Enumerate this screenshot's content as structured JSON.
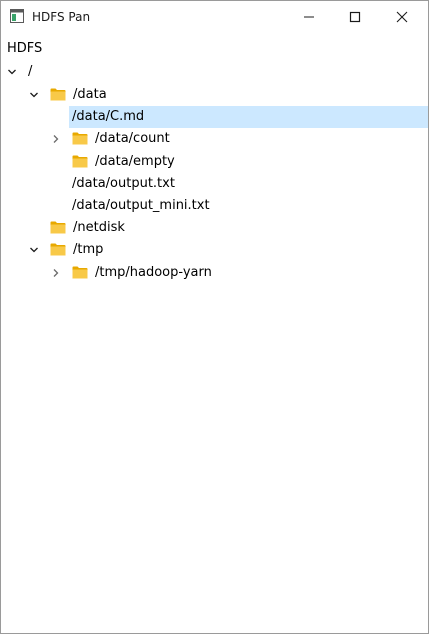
{
  "window": {
    "title": "HDFS Pan",
    "icon": "window-app-icon"
  },
  "titlebar_buttons": [
    "minimize-icon",
    "maximize-icon",
    "close-icon"
  ],
  "tree": {
    "header": "HDFS",
    "items": [
      {
        "label": "/",
        "expanded": true,
        "folder": false,
        "selected": false
      },
      {
        "label": "/data",
        "expanded": true,
        "folder": true,
        "selected": false
      },
      {
        "label": "/data/C.md",
        "expanded": false,
        "folder": false,
        "selected": true
      },
      {
        "label": "/data/count",
        "expanded": false,
        "folder": true,
        "selected": false
      },
      {
        "label": "/data/empty",
        "expanded": false,
        "folder": true,
        "selected": false
      },
      {
        "label": "/data/output.txt",
        "expanded": false,
        "folder": false,
        "selected": false
      },
      {
        "label": "/data/output_mini.txt",
        "expanded": false,
        "folder": false,
        "selected": false
      },
      {
        "label": "/netdisk",
        "expanded": false,
        "folder": true,
        "selected": false
      },
      {
        "label": "/tmp",
        "expanded": true,
        "folder": true,
        "selected": false
      },
      {
        "label": "/tmp/hadoop-yarn",
        "expanded": false,
        "folder": true,
        "selected": false
      }
    ]
  },
  "colors": {
    "selection": "#cce8ff",
    "folder": "#f8c948",
    "folder_dark": "#e8a900"
  }
}
